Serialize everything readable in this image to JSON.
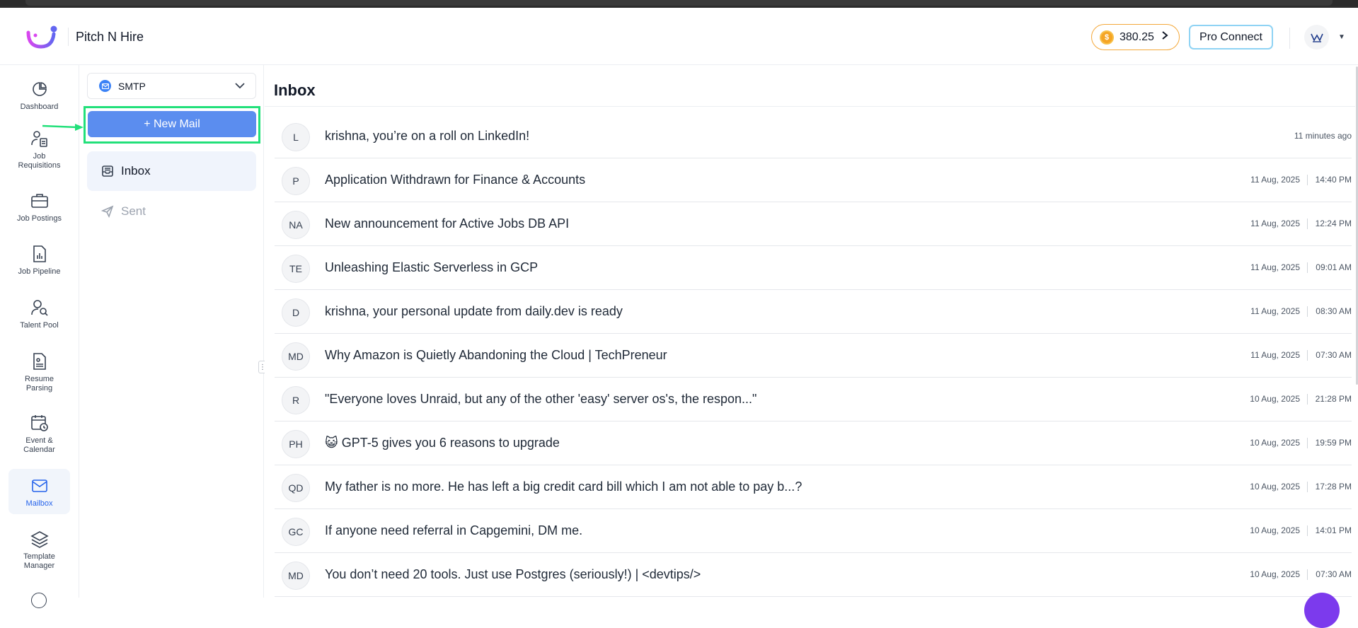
{
  "header": {
    "brand": "Pitch N Hire",
    "coins": "380.25",
    "coin_symbol": "$",
    "pro_connect": "Pro Connect"
  },
  "sidebar": {
    "items": [
      {
        "label": "Dashboard",
        "icon": "pie-chart-icon"
      },
      {
        "label": "Job Requisitions",
        "icon": "user-document-icon"
      },
      {
        "label": "Job Postings",
        "icon": "briefcase-icon"
      },
      {
        "label": "Job Pipeline",
        "icon": "file-chart-icon"
      },
      {
        "label": "Talent Pool",
        "icon": "user-search-icon"
      },
      {
        "label": "Resume Parsing",
        "icon": "document-icon"
      },
      {
        "label": "Event & Calendar",
        "icon": "calendar-clock-icon"
      },
      {
        "label": "Mailbox",
        "icon": "mail-icon",
        "active": true
      },
      {
        "label": "Template Manager",
        "icon": "layers-icon"
      }
    ]
  },
  "panel": {
    "account": "SMTP",
    "new_mail": "+ New Mail",
    "folders": [
      {
        "label": "Inbox",
        "icon": "inbox-icon",
        "active": true
      },
      {
        "label": "Sent",
        "icon": "send-icon",
        "active": false
      }
    ]
  },
  "main": {
    "title": "Inbox",
    "mails": [
      {
        "initials": "L",
        "subject": "krishna, you’re on a roll on LinkedIn!",
        "date": "",
        "time": "11 minutes ago"
      },
      {
        "initials": "P",
        "subject": "Application Withdrawn for Finance & Accounts",
        "date": "11 Aug, 2025",
        "time": "14:40 PM"
      },
      {
        "initials": "NA",
        "subject": "New announcement for Active Jobs DB API",
        "date": "11 Aug, 2025",
        "time": "12:24 PM"
      },
      {
        "initials": "TE",
        "subject": "Unleashing Elastic Serverless in GCP",
        "date": "11 Aug, 2025",
        "time": "09:01 AM"
      },
      {
        "initials": "D",
        "subject": "krishna, your personal update from daily.dev is ready",
        "date": "11 Aug, 2025",
        "time": "08:30 AM"
      },
      {
        "initials": "MD",
        "subject": "Why Amazon is Quietly Abandoning the Cloud | TechPreneur",
        "date": "11 Aug, 2025",
        "time": "07:30 AM"
      },
      {
        "initials": "R",
        "subject": "\"Everyone loves Unraid, but any of the other 'easy' server os's, the respon...\"",
        "date": "10 Aug, 2025",
        "time": "21:28 PM"
      },
      {
        "initials": "PH",
        "subject": "😺 GPT-5 gives you 6 reasons to upgrade",
        "date": "10 Aug, 2025",
        "time": "19:59 PM"
      },
      {
        "initials": "QD",
        "subject": "My father is no more. He has left a big credit card bill which I am not able to pay b...?",
        "date": "10 Aug, 2025",
        "time": "17:28 PM"
      },
      {
        "initials": "GC",
        "subject": "If anyone need referral in Capgemini, DM me.",
        "date": "10 Aug, 2025",
        "time": "14:01 PM"
      },
      {
        "initials": "MD",
        "subject": "You don’t need 20 tools. Just use Postgres (seriously!) | <devtips/>",
        "date": "10 Aug, 2025",
        "time": "07:30 AM"
      }
    ]
  },
  "colors": {
    "accent": "#5b8def",
    "highlight": "#22e07a",
    "coin_border": "#f4a83a",
    "active_nav": "#2563eb"
  }
}
